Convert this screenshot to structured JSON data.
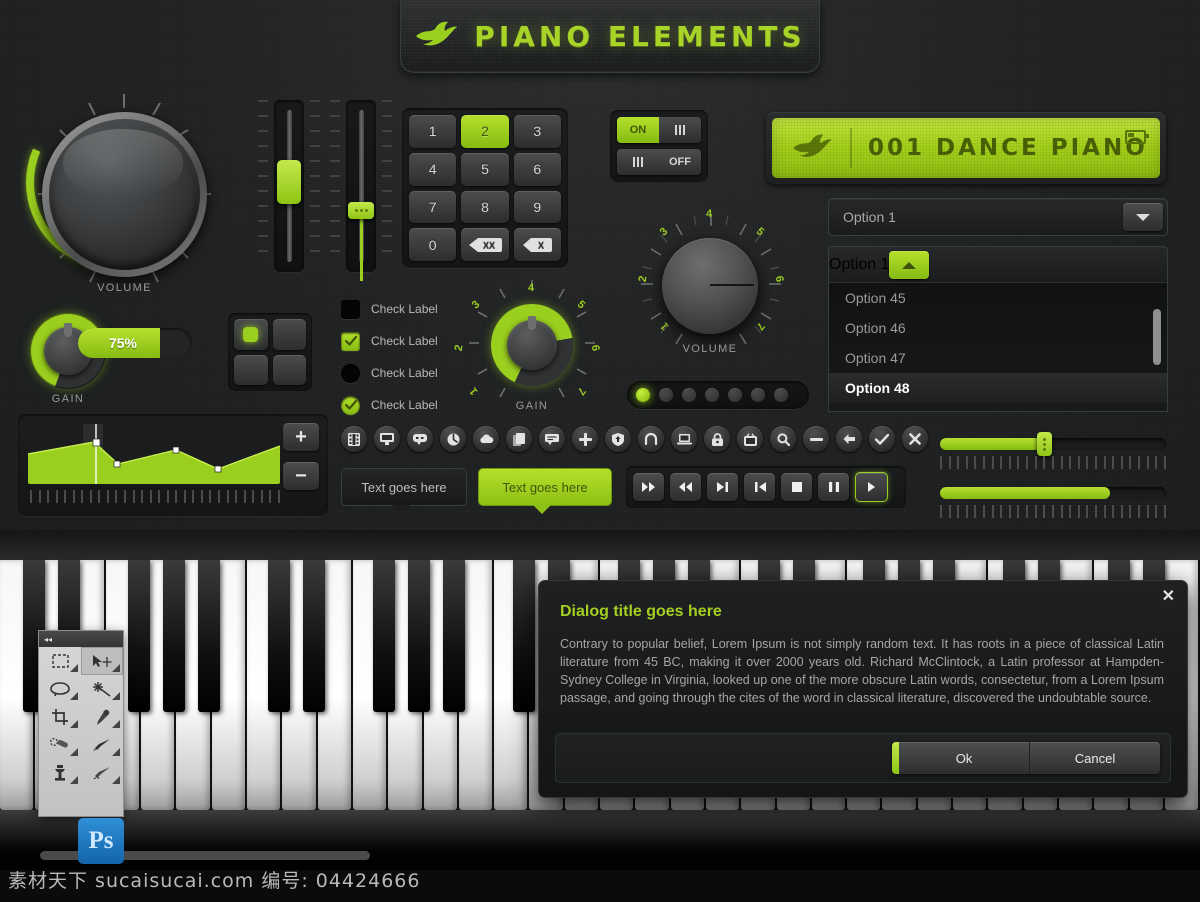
{
  "header": {
    "title": "PIANO ELEMENTS",
    "logo_icon": "bird-icon"
  },
  "volume_knob": {
    "label": "VOLUME",
    "value": 35
  },
  "gain_knob": {
    "label": "GAIN",
    "value_text": "75%",
    "value": 75
  },
  "faders": [
    {
      "name": "fader-1",
      "value": 62
    },
    {
      "name": "fader-2",
      "value": 40
    }
  ],
  "numpad": {
    "keys": [
      "1",
      "2",
      "3",
      "4",
      "5",
      "6",
      "7",
      "8",
      "9",
      "0"
    ],
    "active_key": "2",
    "backspace_xx_label": "XX",
    "backspace_x_label": "X"
  },
  "checkboxes": [
    {
      "label": "Check Label",
      "type": "square",
      "checked": false
    },
    {
      "label": "Check Label",
      "type": "square",
      "checked": true
    },
    {
      "label": "Check Label",
      "type": "radio",
      "checked": false
    },
    {
      "label": "Check Label",
      "type": "radio",
      "checked": true
    }
  ],
  "grid4": {
    "active_index": 0,
    "count": 4
  },
  "center_gain": {
    "label": "GAIN",
    "ticks": [
      "1",
      "2",
      "3",
      "4",
      "5",
      "6",
      "7"
    ],
    "value": 65
  },
  "toggles": [
    {
      "name": "toggle-on",
      "label": "ON",
      "state": "on"
    },
    {
      "name": "toggle-off",
      "label": "OFF",
      "state": "off"
    }
  ],
  "center_volume": {
    "label": "VOLUME",
    "ticks": [
      "1",
      "2",
      "3",
      "4",
      "5",
      "6",
      "7"
    ],
    "value": 50
  },
  "led_strip": {
    "count": 7,
    "active_index": 0
  },
  "display": {
    "text": "001 DANCE PIANO",
    "logo_icon": "bird-icon",
    "battery_icon": "battery-icon"
  },
  "select_closed": {
    "value": "Option 1",
    "caret_icon": "chevron-down-icon"
  },
  "select_open": {
    "value": "Option 1",
    "caret_icon": "chevron-up-icon",
    "options": [
      {
        "label": "Option 45",
        "selected": false
      },
      {
        "label": "Option 46",
        "selected": false
      },
      {
        "label": "Option 47",
        "selected": false
      },
      {
        "label": "Option 48",
        "selected": true
      }
    ]
  },
  "waveform": {
    "plus_label": "+",
    "minus_label": "−",
    "points": [
      0,
      10,
      42,
      18,
      30,
      45,
      26,
      14,
      40
    ]
  },
  "icon_row": [
    "film-icon",
    "monitor-icon",
    "chat-icon",
    "power-icon",
    "cloud-icon",
    "copy-icon",
    "comment-icon",
    "plus-icon",
    "shield-icon",
    "undo-icon",
    "laptop-icon",
    "lock-icon",
    "tv-icon",
    "search-icon",
    "minus-icon",
    "back-arrow-icon",
    "check-icon",
    "close-icon"
  ],
  "tooltips": [
    {
      "name": "tooltip-dark",
      "text": "Text goes here",
      "style": "dark"
    },
    {
      "name": "tooltip-green",
      "text": "Text goes here",
      "style": "green"
    }
  ],
  "transport": [
    {
      "name": "fast-forward-button",
      "icon": "fast-forward-icon",
      "active": false
    },
    {
      "name": "rewind-button",
      "icon": "rewind-icon",
      "active": false
    },
    {
      "name": "next-track-button",
      "icon": "next-track-icon",
      "active": false
    },
    {
      "name": "previous-track-button",
      "icon": "previous-track-icon",
      "active": false
    },
    {
      "name": "stop-button",
      "icon": "stop-icon",
      "active": false
    },
    {
      "name": "pause-button",
      "icon": "pause-icon",
      "active": false
    },
    {
      "name": "play-button",
      "icon": "play-icon",
      "active": true
    }
  ],
  "h_sliders": [
    {
      "name": "h-slider-1",
      "value": 46,
      "has_knob": true
    },
    {
      "name": "h-slider-2",
      "value": 75,
      "has_knob": false
    }
  ],
  "dialog": {
    "title": "Dialog title goes here",
    "body": "Contrary to popular belief, Lorem Ipsum is not simply random text. It has roots in a piece of classical Latin literature from 45 BC, making it over 2000 years old. Richard McClintock, a Latin professor at Hampden-Sydney College in Virginia, looked up one of the more obscure Latin words, consectetur, from a Lorem Ipsum passage, and going through the cites of the word in classical literature, discovered the undoubtable source.",
    "ok_label": "Ok",
    "cancel_label": "Cancel",
    "close_icon": "✕"
  },
  "photoshop": {
    "collapse_icon": "◂◂",
    "logo_text": "Ps",
    "tools": [
      "marquee-tool-icon",
      "move-tool-icon",
      "lasso-tool-icon",
      "magic-wand-tool-icon",
      "crop-tool-icon",
      "eyedropper-tool-icon",
      "healing-brush-tool-icon",
      "brush-tool-icon",
      "clone-stamp-tool-icon",
      "history-brush-tool-icon"
    ],
    "selected_tool_index": 1
  },
  "watermark": {
    "text": "素材天下 sucaisucai.com  编号: 04424666"
  },
  "colors": {
    "accent_green": "#9ace1f",
    "green_light": "#c3e84c",
    "green_dark": "#86bb12",
    "panel_bg": "#202223",
    "text_muted": "#9a9a9a"
  }
}
